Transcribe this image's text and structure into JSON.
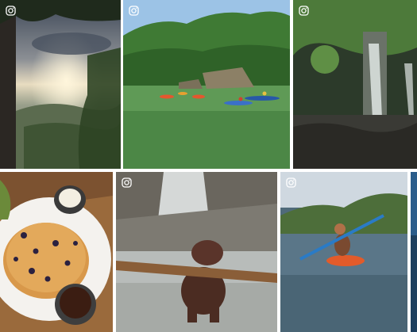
{
  "gallery": {
    "icon": "instagram-icon",
    "accent_border": "#ffffff",
    "posts": [
      {
        "name": "post-sunset-forest-view",
        "subject": "sunset-forest",
        "show_icon": true
      },
      {
        "name": "post-lake-kayakers",
        "subject": "lake-kayaks",
        "show_icon": true
      },
      {
        "name": "post-forest-waterfall",
        "subject": "waterfall-forest",
        "show_icon": true
      },
      {
        "name": "post-blueberry-pancakes",
        "subject": "pancakes",
        "show_icon": false
      },
      {
        "name": "post-dog-with-stick",
        "subject": "dog-stick",
        "show_icon": true
      },
      {
        "name": "post-river-kayaker",
        "subject": "river-kayak",
        "show_icon": true
      },
      {
        "name": "post-partial-edge",
        "subject": "partial",
        "show_icon": false
      }
    ]
  }
}
